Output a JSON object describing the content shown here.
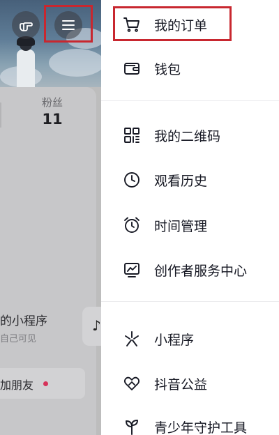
{
  "profile": {
    "fans_label": "粉丝",
    "fans_count": "11",
    "mini_program_title": "的小程序",
    "mini_program_sub": "自己可见",
    "music_glyph": "♪",
    "add_friend_label": "加朋友"
  },
  "icons": {
    "hand": "hand-pointing-icon",
    "menu": "hamburger-menu-icon"
  },
  "drawer": {
    "items": [
      {
        "label": "我的订单",
        "icon": "shopping-cart-icon"
      },
      {
        "label": "钱包",
        "icon": "wallet-icon"
      },
      {
        "label": "我的二维码",
        "icon": "qr-code-icon"
      },
      {
        "label": "观看历史",
        "icon": "clock-icon"
      },
      {
        "label": "时间管理",
        "icon": "alarm-clock-icon"
      },
      {
        "label": "创作者服务中心",
        "icon": "creator-chart-icon"
      },
      {
        "label": "小程序",
        "icon": "mini-program-icon"
      },
      {
        "label": "抖音公益",
        "icon": "charity-heart-icon"
      },
      {
        "label": "青少年守护工具",
        "icon": "sprout-icon"
      }
    ]
  },
  "colors": {
    "highlight": "#c8272f",
    "notification_dot": "#d6335a",
    "text_primary": "#161823"
  }
}
